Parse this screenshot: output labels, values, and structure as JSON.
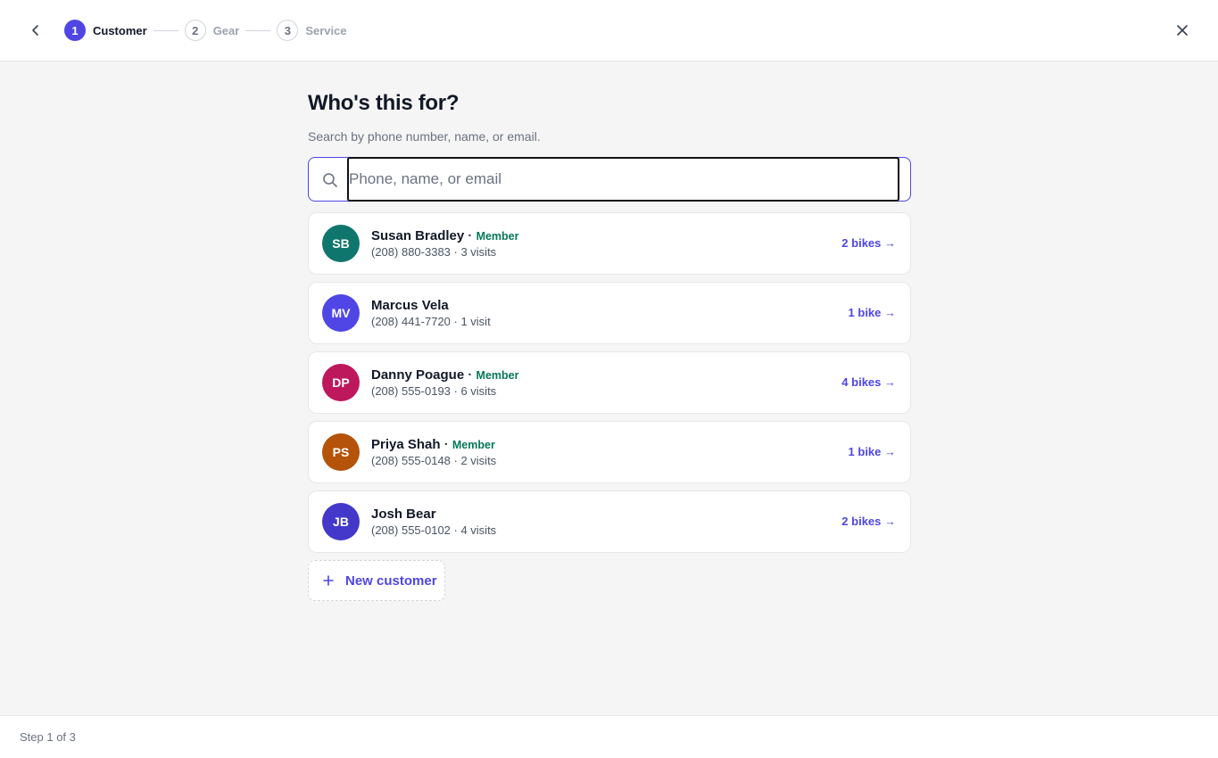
{
  "header": {
    "steps": [
      {
        "number": "1",
        "label": "Customer",
        "state": "active"
      },
      {
        "number": "2",
        "label": "Gear",
        "state": "inactive"
      },
      {
        "number": "3",
        "label": "Service",
        "state": "inactive"
      }
    ],
    "back_icon": "chevron-left-icon",
    "close_icon": "close-icon"
  },
  "main": {
    "title": "Who's this for?",
    "subtitle": "Search by phone number, name, or email.",
    "search": {
      "placeholder": "Phone, name, or email",
      "value": "",
      "icon": "search-icon"
    },
    "customers": [
      {
        "initials": "SB",
        "name": "Susan Bradley",
        "member": "Member",
        "meta": "(208) 880-3383 · 3 visits",
        "bikes": "2 bikes →",
        "avatar_color": "#0f766e"
      },
      {
        "initials": "MV",
        "name": "Marcus Vela",
        "member": "",
        "meta": "(208) 441-7720 · 1 visit",
        "bikes": "1 bike →",
        "avatar_color": "#4f46e5"
      },
      {
        "initials": "DP",
        "name": "Danny Poague",
        "member": "Member",
        "meta": "(208) 555-0193 · 6 visits",
        "bikes": "4 bikes →",
        "avatar_color": "#be185d"
      },
      {
        "initials": "PS",
        "name": "Priya Shah",
        "member": "Member",
        "meta": "(208) 555-0148 · 2 visits",
        "bikes": "1 bike →",
        "avatar_color": "#b45309"
      },
      {
        "initials": "JB",
        "name": "Josh Bear",
        "member": "",
        "meta": "(208) 555-0102 · 4 visits",
        "bikes": "2 bikes →",
        "avatar_color": "#4338ca"
      }
    ],
    "new_customer_label": "New customer"
  },
  "footer": {
    "step_text": "Step 1 of 3"
  },
  "colors": {
    "accent": "#4f46e5",
    "member": "#047857",
    "background": "#f5f5f5"
  }
}
